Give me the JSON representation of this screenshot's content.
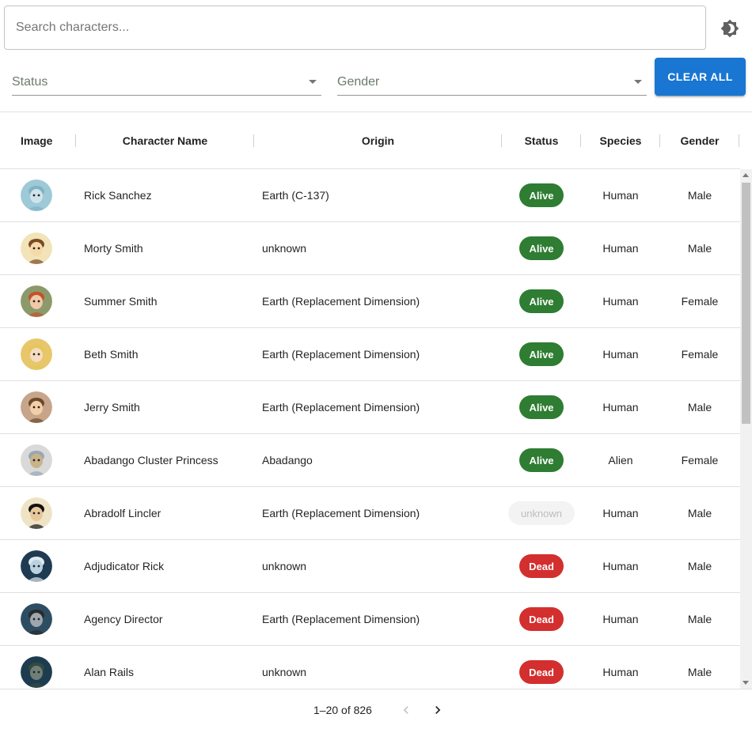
{
  "search": {
    "placeholder": "Search characters..."
  },
  "filters": {
    "status_label": "Status",
    "gender_label": "Gender",
    "clear_label": "CLEAR ALL"
  },
  "colors": {
    "primary": "#1976d2",
    "alive": "#2e7d32",
    "dead": "#d32f2f",
    "unknown_bg": "#f3f3f3"
  },
  "table": {
    "columns": [
      "Image",
      "Character Name",
      "Origin",
      "Status",
      "Species",
      "Gender"
    ],
    "rows": [
      {
        "name": "Rick Sanchez",
        "origin": "Earth (C-137)",
        "status": "Alive",
        "species": "Human",
        "gender": "Male",
        "avatar": "rick-avatar"
      },
      {
        "name": "Morty Smith",
        "origin": "unknown",
        "status": "Alive",
        "species": "Human",
        "gender": "Male",
        "avatar": "morty-avatar"
      },
      {
        "name": "Summer Smith",
        "origin": "Earth (Replacement Dimension)",
        "status": "Alive",
        "species": "Human",
        "gender": "Female",
        "avatar": "summer-avatar"
      },
      {
        "name": "Beth Smith",
        "origin": "Earth (Replacement Dimension)",
        "status": "Alive",
        "species": "Human",
        "gender": "Female",
        "avatar": "beth-avatar"
      },
      {
        "name": "Jerry Smith",
        "origin": "Earth (Replacement Dimension)",
        "status": "Alive",
        "species": "Human",
        "gender": "Male",
        "avatar": "jerry-avatar"
      },
      {
        "name": "Abadango Cluster Princess",
        "origin": "Abadango",
        "status": "Alive",
        "species": "Alien",
        "gender": "Female",
        "avatar": "abadango-avatar"
      },
      {
        "name": "Abradolf Lincler",
        "origin": "Earth (Replacement Dimension)",
        "status": "unknown",
        "species": "Human",
        "gender": "Male",
        "avatar": "abradolf-avatar"
      },
      {
        "name": "Adjudicator Rick",
        "origin": "unknown",
        "status": "Dead",
        "species": "Human",
        "gender": "Male",
        "avatar": "adjudicator-avatar"
      },
      {
        "name": "Agency Director",
        "origin": "Earth (Replacement Dimension)",
        "status": "Dead",
        "species": "Human",
        "gender": "Male",
        "avatar": "agency-avatar"
      },
      {
        "name": "Alan Rails",
        "origin": "unknown",
        "status": "Dead",
        "species": "Human",
        "gender": "Male",
        "avatar": "alan-avatar"
      }
    ]
  },
  "pagination": {
    "range_text": "1–20 of 826"
  }
}
